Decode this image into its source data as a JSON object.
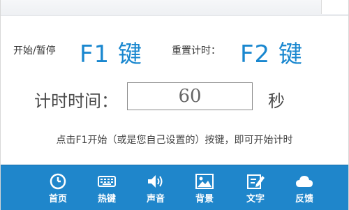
{
  "header": {
    "start_pause_label": "开始/暂停",
    "start_pause_key": "F1 键",
    "reset_label": "重置计时：",
    "reset_key": "F2 键"
  },
  "timer": {
    "label": "计时时间：",
    "value": "60",
    "unit": "秒"
  },
  "hint": "点击F1开始（或是您自己设置的）按键，即可开始计时",
  "toolbar": {
    "items": [
      {
        "label": "首页",
        "icon": "home-clock-icon"
      },
      {
        "label": "热键",
        "icon": "keyboard-icon"
      },
      {
        "label": "声音",
        "icon": "speaker-icon"
      },
      {
        "label": "背景",
        "icon": "image-icon"
      },
      {
        "label": "文字",
        "icon": "edit-text-icon"
      },
      {
        "label": "反馈",
        "icon": "cloud-icon"
      }
    ]
  },
  "colors": {
    "accent": "#1987cf",
    "toolbar_bg": "#1f86cb"
  }
}
